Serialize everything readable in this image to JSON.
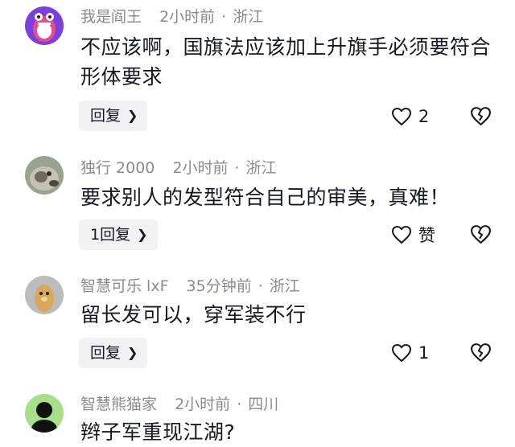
{
  "comments": [
    {
      "username": "我是阎王",
      "time": "2小时前",
      "location": "浙江",
      "text": "不应该啊，国旗法应该加上升旗手必须要符合形体要求",
      "reply_label": "回复",
      "like_count": "2",
      "avatar_icon": "purple-monster-avatar-icon"
    },
    {
      "username": "独行 2000",
      "time": "2小时前",
      "location": "浙江",
      "text": "要求别人的发型符合自己的审美，真难！",
      "reply_label": "1回复",
      "like_count": "赞",
      "avatar_icon": "animal-photo-avatar-icon"
    },
    {
      "username": "智慧可乐 lxF",
      "time": "35分钟前",
      "location": "浙江",
      "text": "留长发可以，穿军装不行",
      "reply_label": "回复",
      "like_count": "1",
      "avatar_icon": "cartoon-bear-avatar-icon"
    },
    {
      "username": "智慧熊猫家",
      "time": "2小时前",
      "location": "四川",
      "text": "辫子军重现江湖?",
      "avatar_icon": "black-character-avatar-icon"
    }
  ],
  "meta_separator": "·",
  "colors": {
    "meta_text": "#8a8b91",
    "body_text": "#161823",
    "reply_bg": "#f2f2f4"
  }
}
